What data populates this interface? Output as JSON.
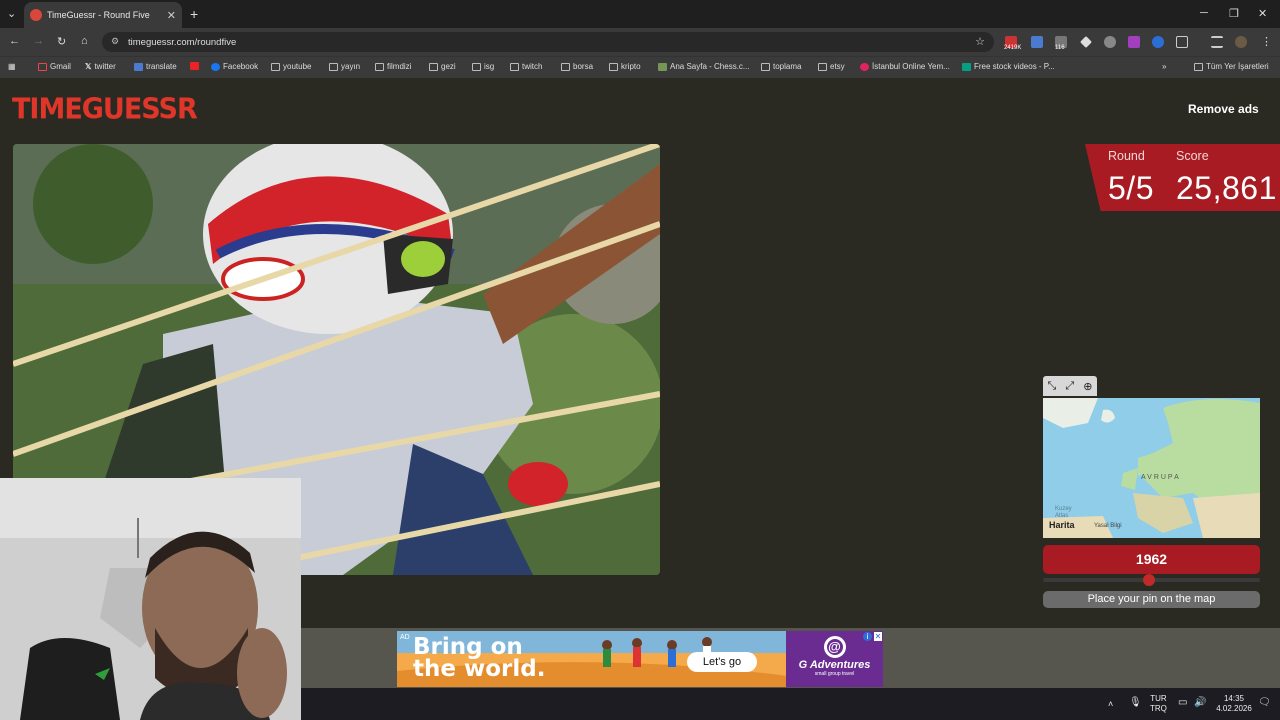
{
  "browser": {
    "tab_title": "TimeGuessr - Round Five",
    "url": "timeguessr.com/roundfive",
    "new_tab": "+",
    "bookmarks": [
      "Gmail",
      "twitter",
      "translate",
      "Facebook",
      "youtube",
      "yayın",
      "filmdizi",
      "gezi",
      "isg",
      "twitch",
      "borsa",
      "kripto",
      "Ana Sayfa - Chess.c...",
      "toplama",
      "etsy",
      "İstanbul Online Yem...",
      "Free stock videos - P..."
    ],
    "all_bookmarks": "Tüm Yer İşaretleri",
    "ext_badge_1": "2419K",
    "ext_badge_2": "116"
  },
  "page": {
    "logo": "TIMEGUESSR",
    "remove_ads": "Remove ads",
    "round_label": "Round",
    "score_label": "Score",
    "round_value": "5/5",
    "score_value": "25,861",
    "map_region_label": "AVRUPA",
    "map_apple_label": "Harita",
    "map_legal": "Yasal Bilgi",
    "map_sea_label": "Kuzey Atlas",
    "year": "1962",
    "year_slider_fraction": 0.49,
    "place_pin": "Place your pin on the map"
  },
  "ad": {
    "tag": "AD",
    "headline_1": "Bring on",
    "headline_2": "the world.",
    "cta": "Let's go",
    "brand": "G Adventures",
    "brand_sub": "small group travel"
  },
  "taskbar": {
    "lang_1": "TUR",
    "lang_2": "TRQ",
    "time": "14:35",
    "date": "4.02.2026"
  },
  "colors": {
    "accent_red": "#a81b22",
    "page_bg": "#2b2a22"
  }
}
